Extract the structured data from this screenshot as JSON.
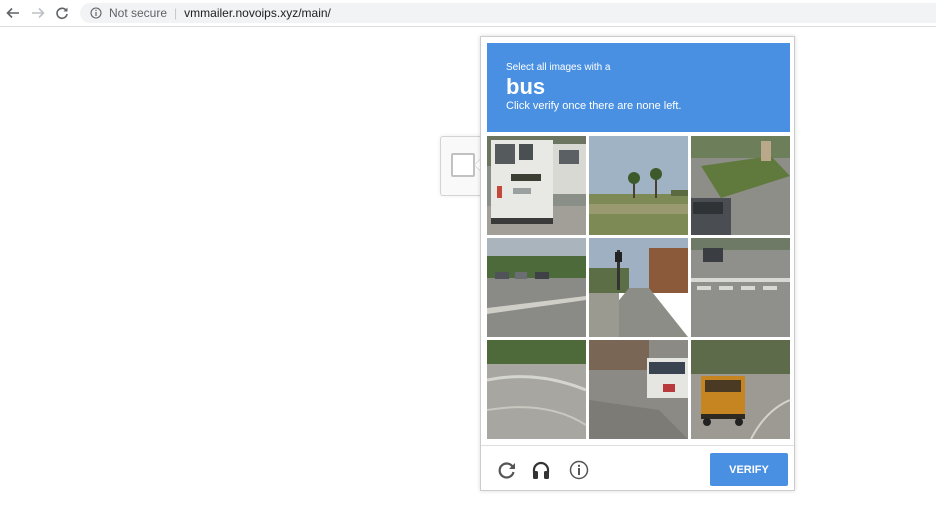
{
  "browser": {
    "security_label": "Not secure",
    "separator": "|",
    "url": "vmmailer.novoips.xyz/main/"
  },
  "challenge": {
    "instruction_small": "Select all images with a",
    "target_object": "bus",
    "instruction_sub": "Click verify once there are none left.",
    "header_color": "#4a90e2",
    "tiles": [
      {
        "scene": "bus-rear-close-up"
      },
      {
        "scene": "palm-trees-grass"
      },
      {
        "scene": "grass-median-car"
      },
      {
        "scene": "parking-lot-trees"
      },
      {
        "scene": "road-traffic-light"
      },
      {
        "scene": "crosswalk-car"
      },
      {
        "scene": "curved-road-trees"
      },
      {
        "scene": "road-bus-side"
      },
      {
        "scene": "yellow-school-bus"
      }
    ],
    "footer": {
      "reload_icon": "reload-icon",
      "audio_icon": "headphones-icon",
      "info_icon": "info-icon",
      "verify_label": "VERIFY"
    }
  }
}
